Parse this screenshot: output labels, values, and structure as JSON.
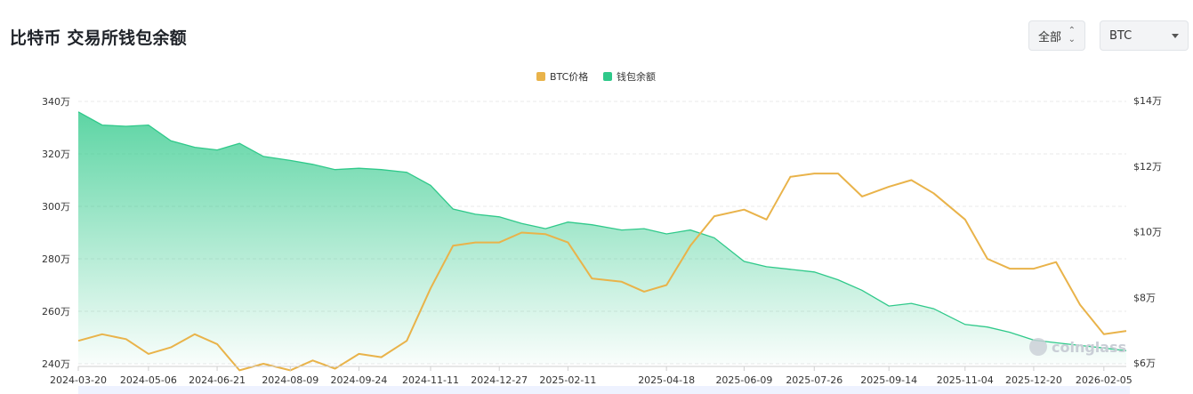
{
  "header": {
    "title": "比特币 交易所钱包余额"
  },
  "controls": {
    "range_label": "全部",
    "range_icon": "sort-updown-icon",
    "coin_label": "BTC",
    "coin_icon": "chevron-down-icon"
  },
  "watermark": {
    "text": "coinglass"
  },
  "colors": {
    "price": "#e9b34a",
    "balance": "#2fc98a",
    "grid": "#e9e9e9",
    "axis_text": "#333333"
  },
  "chart_data": {
    "type": "line",
    "title": "",
    "legend": {
      "placement": "top-center",
      "entries": [
        "BTC价格",
        "钱包余额"
      ]
    },
    "x": [
      "2024-03-20",
      "2024-04-05",
      "2024-04-21",
      "2024-05-06",
      "2024-05-21",
      "2024-06-06",
      "2024-06-21",
      "2024-07-06",
      "2024-07-22",
      "2024-08-09",
      "2024-08-24",
      "2024-09-08",
      "2024-09-24",
      "2024-10-09",
      "2024-10-26",
      "2024-11-11",
      "2024-11-26",
      "2024-12-11",
      "2024-12-27",
      "2025-01-11",
      "2025-01-27",
      "2025-02-11",
      "2025-02-27",
      "2025-03-19",
      "2025-04-03",
      "2025-04-18",
      "2025-05-04",
      "2025-05-20",
      "2025-06-09",
      "2025-06-24",
      "2025-07-10",
      "2025-07-26",
      "2025-08-11",
      "2025-08-27",
      "2025-09-14",
      "2025-09-29",
      "2025-10-14",
      "2025-11-04",
      "2025-11-19",
      "2025-12-04",
      "2025-12-20",
      "2026-01-04",
      "2026-01-20",
      "2026-02-05",
      "2026-02-20"
    ],
    "x_tick_labels": [
      "2024-03-20",
      "2024-05-06",
      "2024-06-21",
      "2024-08-09",
      "2024-09-24",
      "2024-11-11",
      "2024-12-27",
      "2025-02-11",
      "2025-04-18",
      "2025-06-09",
      "2025-07-26",
      "2025-09-14",
      "2025-11-04",
      "2025-12-20",
      "2026-02-05"
    ],
    "y_left": {
      "label": "",
      "ticks": [
        "240万",
        "260万",
        "280万",
        "300万",
        "320万",
        "340万"
      ],
      "range": [
        2400000,
        3400000
      ]
    },
    "y_right": {
      "label": "",
      "ticks": [
        "$6万",
        "$8万",
        "$10万",
        "$12万",
        "$14万"
      ],
      "range": [
        60000,
        140000
      ]
    },
    "grid": true,
    "series": [
      {
        "name": "钱包余额",
        "axis": "left",
        "type": "area",
        "values": [
          3360000,
          3310000,
          3305000,
          3310000,
          3250000,
          3225000,
          3215000,
          3240000,
          3190000,
          3175000,
          3160000,
          3140000,
          3145000,
          3140000,
          3130000,
          3080000,
          2990000,
          2970000,
          2960000,
          2935000,
          2915000,
          2940000,
          2930000,
          2910000,
          2915000,
          2895000,
          2910000,
          2880000,
          2790000,
          2770000,
          2760000,
          2750000,
          2720000,
          2680000,
          2620000,
          2630000,
          2610000,
          2550000,
          2540000,
          2520000,
          2490000,
          2480000,
          2470000,
          2460000,
          2450000
        ]
      },
      {
        "name": "BTC价格",
        "axis": "right",
        "type": "line",
        "values": [
          67000,
          69000,
          67500,
          63000,
          65000,
          69000,
          66000,
          58000,
          60000,
          58000,
          61000,
          58500,
          63000,
          62000,
          67000,
          83000,
          96000,
          97000,
          97000,
          100000,
          99500,
          97000,
          86000,
          85000,
          82000,
          84000,
          96000,
          105000,
          107000,
          104000,
          117000,
          118000,
          118000,
          111000,
          114000,
          116000,
          112000,
          104000,
          92000,
          89000,
          89000,
          91000,
          78000,
          69000,
          70000
        ]
      }
    ]
  }
}
